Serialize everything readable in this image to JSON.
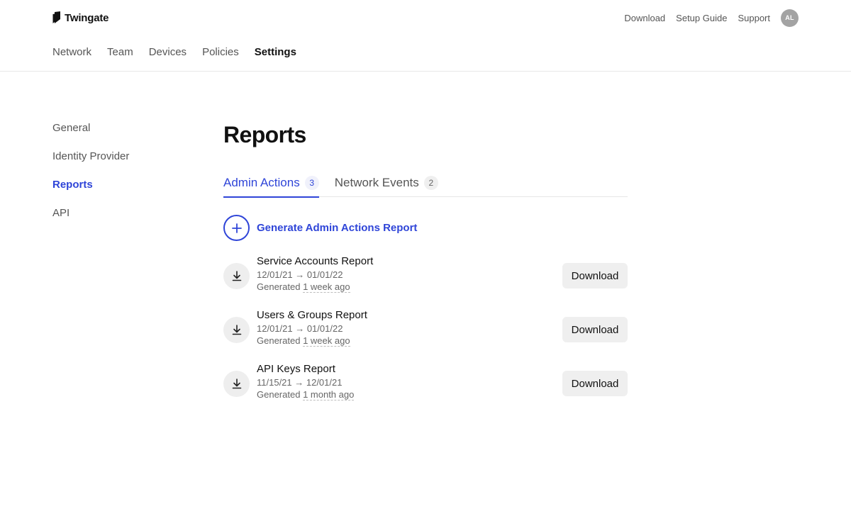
{
  "brand": {
    "name": "Twingate",
    "logo_icon": "twingate-logo-icon"
  },
  "top_links": [
    {
      "label": "Download"
    },
    {
      "label": "Setup Guide"
    },
    {
      "label": "Support"
    }
  ],
  "user": {
    "initials": "AL"
  },
  "main_nav": [
    {
      "label": "Network",
      "active": false
    },
    {
      "label": "Team",
      "active": false
    },
    {
      "label": "Devices",
      "active": false
    },
    {
      "label": "Policies",
      "active": false
    },
    {
      "label": "Settings",
      "active": true
    }
  ],
  "side_nav": [
    {
      "label": "General",
      "active": false
    },
    {
      "label": "Identity Provider",
      "active": false
    },
    {
      "label": "Reports",
      "active": true
    },
    {
      "label": "API",
      "active": false
    }
  ],
  "page": {
    "title": "Reports"
  },
  "tabs": [
    {
      "label": "Admin Actions",
      "count": "3",
      "active": true
    },
    {
      "label": "Network Events",
      "count": "2",
      "active": false
    }
  ],
  "generate": {
    "label": "Generate Admin Actions Report",
    "icon": "plus-icon"
  },
  "reports": [
    {
      "name": "Service Accounts Report",
      "range": "12/01/21 → 01/01/22",
      "generated_prefix": "Generated",
      "generated_ago": "1 week ago",
      "button": "Download"
    },
    {
      "name": "Users & Groups Report",
      "range": "12/01/21 → 01/01/22",
      "generated_prefix": "Generated",
      "generated_ago": "1 week ago",
      "button": "Download"
    },
    {
      "name": "API Keys Report",
      "range": "11/15/21 → 12/01/21",
      "generated_prefix": "Generated",
      "generated_ago": "1 month ago",
      "button": "Download"
    }
  ],
  "colors": {
    "accent": "#2f45d8",
    "muted_text": "#555555",
    "button_bg": "#efefef",
    "avatar_bg": "#a3a3a3"
  }
}
